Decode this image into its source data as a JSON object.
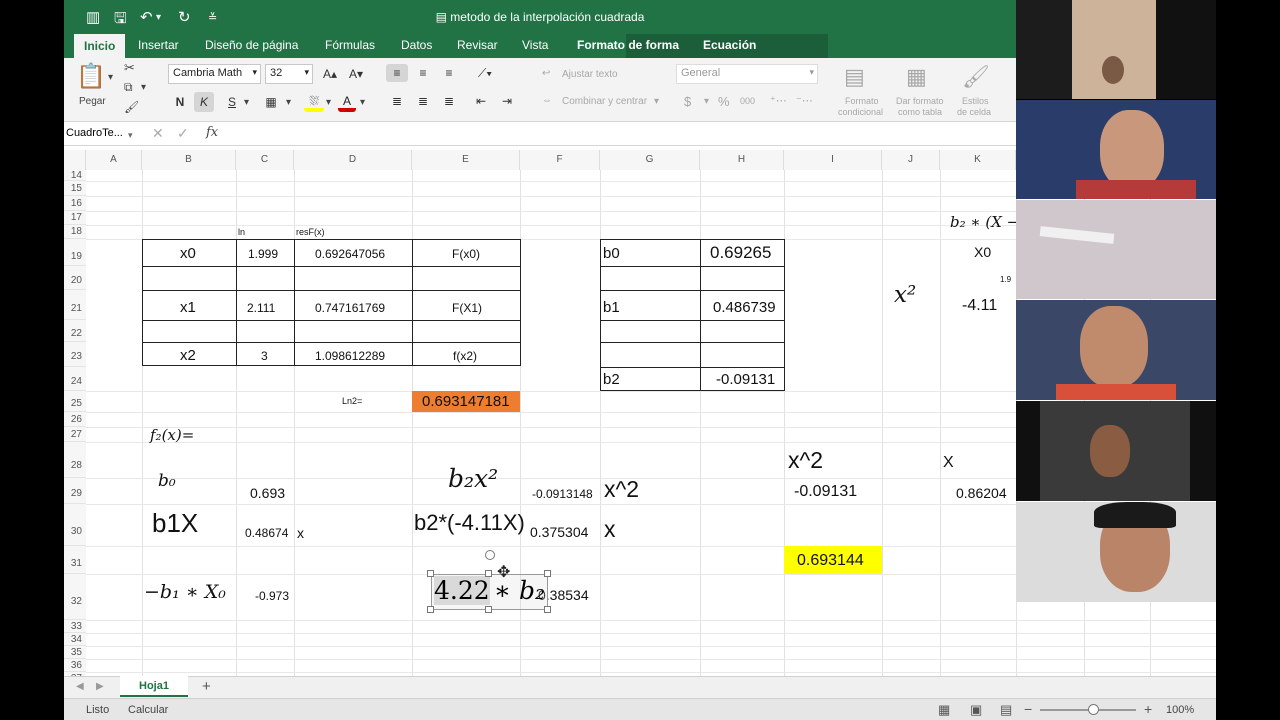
{
  "window": {
    "title": "metodo de la interpolación cuadrada"
  },
  "ribbon": {
    "tabs": [
      "Inicio",
      "Insertar",
      "Diseño de página",
      "Fórmulas",
      "Datos",
      "Revisar",
      "Vista",
      "Formato de forma",
      "Ecuación"
    ],
    "paste_label": "Pegar",
    "font_name": "Cambria Math",
    "font_size": "32",
    "bold": "N",
    "italic": "K",
    "underline": "S",
    "wrap_text": "Ajustar texto",
    "merge_center": "Combinar y centrar",
    "number_format": "General",
    "currency": "$",
    "percent": "%",
    "thousands": "000",
    "cond_format_1": "Formato",
    "cond_format_2": "condicional",
    "table_format_1": "Dar formato",
    "table_format_2": "como tabla",
    "cell_styles_1": "Estilos",
    "cell_styles_2": "de celda"
  },
  "formula_bar": {
    "name_box": "CuadroTe...",
    "fx": "fx"
  },
  "columns": [
    "A",
    "B",
    "C",
    "D",
    "E",
    "F",
    "G",
    "H",
    "I",
    "J",
    "K"
  ],
  "rows": [
    "14",
    "15",
    "16",
    "17",
    "18",
    "19",
    "20",
    "21",
    "22",
    "23",
    "24",
    "25",
    "26",
    "27",
    "28",
    "29",
    "30",
    "31",
    "32",
    "33",
    "34",
    "35",
    "36",
    "37"
  ],
  "cells": {
    "c18": "ln",
    "d18": "resF(x)",
    "b19": "x0",
    "c19": "1.999",
    "d19": "0.692647056",
    "e19": "F(x0)",
    "g19": "b0",
    "h19": "0.69265",
    "b21": "x1",
    "c21": "2.111",
    "d21": "0.747161769",
    "e21": "F(X1)",
    "g21": "b1",
    "h21": "0.486739",
    "b23": "x2",
    "c23": "3",
    "d23": "1.098612289",
    "e23": "f(x2)",
    "g24": "b2",
    "h24": "-0.09131",
    "d25": "Ln2=",
    "e25": "0.693147181",
    "i28": "x^2",
    "j28": "X",
    "c29": "0.693",
    "f29": "-0.0913148",
    "g29": "x^2",
    "i29": "-0.09131",
    "k29": "0.86204",
    "b30": "b1X",
    "c30": "0.48674",
    "c30b": "x",
    "e30": "b2*(-4.11X)",
    "f30": "0.375304",
    "g30": "x",
    "i31": "0.693144",
    "c32": "-0.973",
    "f32": "0.38534",
    "k19": "X0",
    "k20": "1.9",
    "k21": "-4.11"
  },
  "equations": {
    "f2": "f₂(x)=",
    "b0": "b₀",
    "b2x2": "b₂x²",
    "neg_b1x0": "−b₁ ∗ X₀",
    "selected_num": "4.22",
    "selected_rest": "∗ b₂",
    "x2": "x²",
    "k18": "b₂ ∗ (X −"
  },
  "sheet_tabs": [
    "Hoja1"
  ],
  "status": {
    "left1": "Listo",
    "left2": "Calcular",
    "zoom": "100%"
  },
  "colors": {
    "excel_green": "#217346",
    "orange_fill": "#ed7d31",
    "yellow_fill": "#ffff00"
  }
}
